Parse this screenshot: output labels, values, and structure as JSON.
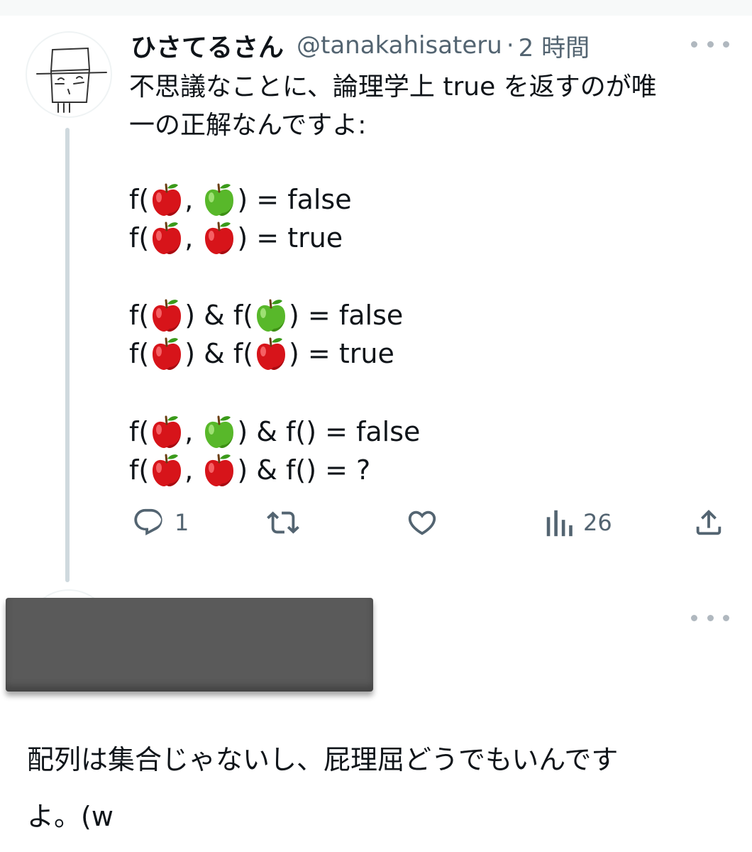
{
  "tweet": {
    "display_name": "ひさてるさん",
    "handle": "@tanakahisateru",
    "separator": "·",
    "time": "2 時間",
    "text_line1": "不思議なことに、論理学上 true を返すのが唯",
    "text_line2": "一の正解なんですよ:",
    "code_lines": [
      {
        "pre": "f(",
        "mid": ", ",
        "post": ") = false",
        "apples": [
          "red",
          "green"
        ],
        "type": "pair"
      },
      {
        "pre": "f(",
        "mid": ", ",
        "post": ") = true",
        "apples": [
          "red",
          "red"
        ],
        "type": "pair"
      },
      {
        "pre": "f(",
        "mid": ") & f(",
        "post": ") = false",
        "apples": [
          "red",
          "green"
        ],
        "type": "split"
      },
      {
        "pre": "f(",
        "mid": ") & f(",
        "post": ") = true",
        "apples": [
          "red",
          "red"
        ],
        "type": "split"
      },
      {
        "pre": "f(",
        "mid": ", ",
        "post": ") & f() = false",
        "apples": [
          "red",
          "green"
        ],
        "type": "pair"
      },
      {
        "pre": "f(",
        "mid": ", ",
        "post": ") & f() = ?",
        "apples": [
          "red",
          "red"
        ],
        "type": "pair"
      }
    ],
    "actions": {
      "reply_count": "1",
      "retweet_count": "",
      "like_count": "",
      "views_count": "26"
    }
  },
  "reply": {
    "text_line1": "配列は集合じゃないし、屁理屈どうでもいんです",
    "text_line2": "よ。(w"
  },
  "colors": {
    "text": "#0f1419",
    "secondary": "#536471",
    "thread_line": "#cfd9de",
    "redaction": "#5a5a5a"
  },
  "icons": [
    "reply-icon",
    "retweet-icon",
    "like-icon",
    "views-icon",
    "share-icon",
    "more-icon",
    "red-apple-icon",
    "green-apple-icon"
  ]
}
